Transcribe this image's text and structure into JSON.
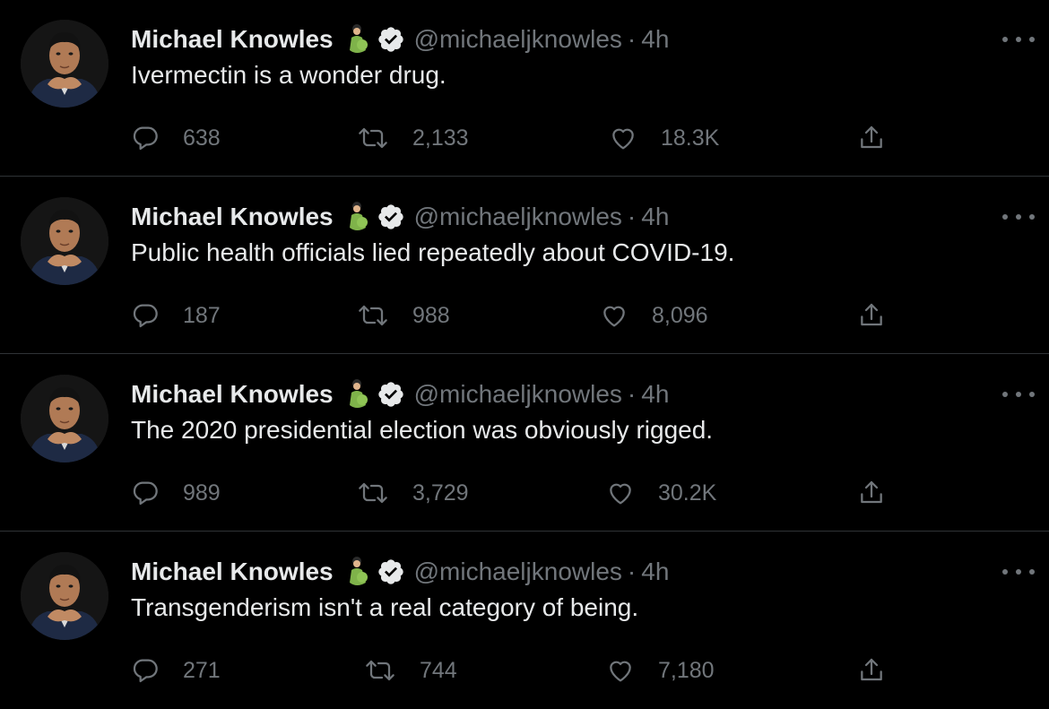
{
  "colors": {
    "background": "#000000",
    "text_primary": "#e7e9ea",
    "text_secondary": "#71767b",
    "divider": "#2f3336",
    "verified_badge": "#e7e9ea"
  },
  "icons": {
    "reply": "reply-icon",
    "retweet": "retweet-icon",
    "like": "heart-icon",
    "share": "share-icon",
    "more": "more-icon",
    "verified": "verified-icon",
    "name_emoji": "pregnant-person-emoji"
  },
  "tweets": [
    {
      "author": "Michael Knowles",
      "handle": "@michaeljknowles",
      "separator": "·",
      "time": "4h",
      "text": "Ivermectin is a wonder drug.",
      "replies": "638",
      "retweets": "2,133",
      "likes": "18.3K"
    },
    {
      "author": "Michael Knowles",
      "handle": "@michaeljknowles",
      "separator": "·",
      "time": "4h",
      "text": "Public health officials lied repeatedly about COVID-19.",
      "replies": "187",
      "retweets": "988",
      "likes": "8,096"
    },
    {
      "author": "Michael Knowles",
      "handle": "@michaeljknowles",
      "separator": "·",
      "time": "4h",
      "text": "The 2020 presidential election was obviously rigged.",
      "replies": "989",
      "retweets": "3,729",
      "likes": "30.2K"
    },
    {
      "author": "Michael Knowles",
      "handle": "@michaeljknowles",
      "separator": "·",
      "time": "4h",
      "text": "Transgenderism isn't a real category of being.",
      "replies": "271",
      "retweets": "744",
      "likes": "7,180"
    }
  ]
}
